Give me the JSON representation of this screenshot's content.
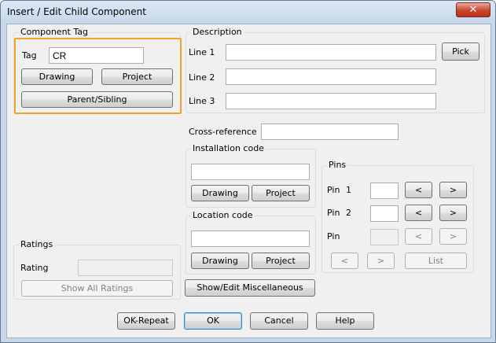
{
  "window": {
    "title": "Insert / Edit Child Component",
    "close_glyph": "✕"
  },
  "component_tag": {
    "legend": "Component Tag",
    "tag_label": "Tag",
    "tag_value": "CR",
    "drawing_button": "Drawing",
    "project_button": "Project",
    "parent_sibling_button": "Parent/Sibling"
  },
  "description": {
    "legend": "Description",
    "line1_label": "Line 1",
    "line2_label": "Line 2",
    "line3_label": "Line 3",
    "line1_value": "",
    "line2_value": "",
    "line3_value": "",
    "pick_button": "Pick"
  },
  "cross_reference": {
    "label": "Cross-reference",
    "value": ""
  },
  "installation_code": {
    "legend": "Installation code",
    "value": "",
    "drawing_button": "Drawing",
    "project_button": "Project"
  },
  "location_code": {
    "legend": "Location code",
    "value": "",
    "drawing_button": "Drawing",
    "project_button": "Project"
  },
  "pins": {
    "legend": "Pins",
    "pin1_label": "Pin",
    "pin1_num": "1",
    "pin2_label": "Pin",
    "pin2_num": "2",
    "pin3_label": "Pin",
    "prev_glyph": "<",
    "next_glyph": ">",
    "list_button": "List"
  },
  "ratings": {
    "legend": "Ratings",
    "rating_label": "Rating",
    "show_all_button": "Show All Ratings"
  },
  "misc_button": "Show/Edit Miscellaneous",
  "footer": {
    "ok_repeat": "OK-Repeat",
    "ok": "OK",
    "cancel": "Cancel",
    "help": "Help"
  }
}
